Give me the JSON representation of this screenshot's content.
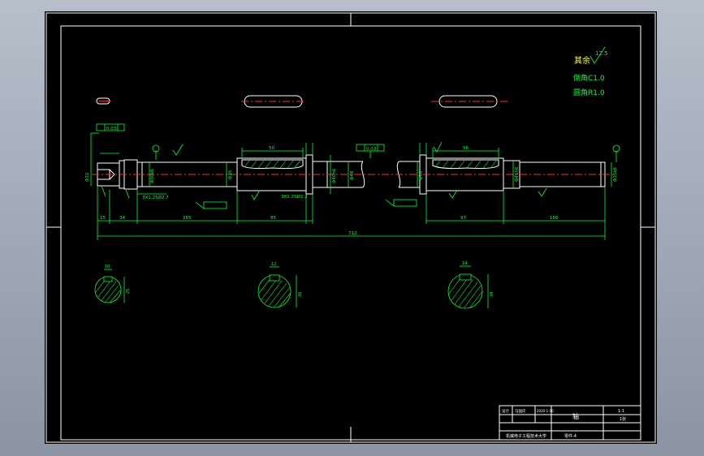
{
  "notes": {
    "rest_roughness_label": "其余",
    "rest_roughness_value": "12.5",
    "chamfer": "倒角C1.0",
    "fillet": "圆角R1.0"
  },
  "dimensions": {
    "overall_length": "712",
    "seg_left_a": "15",
    "seg_left_b": "34",
    "seg_left_c": "265",
    "seg_key_a": "85",
    "seg_right_a": "97",
    "seg_right_b": "186",
    "keyway_left_len": "50",
    "keyway_right_len": "56",
    "diam_left_end": "Φ32",
    "diam_bearing_left": "Φ30k6",
    "diam_body_left": "Φ35",
    "diam_key_left": "Φ40h6",
    "diam_collar": "Φ48",
    "diam_center": "Φ50",
    "diam_key_right": "Φ45h6",
    "diam_right_end": "Φ35k6",
    "keyway_depth_left": "3X1.25Ø2.2",
    "key_label": "3X1.25Ø2.7",
    "tol_left": "0.03",
    "tol_right": "0.03",
    "section_a_w": "10",
    "section_a_h": "25",
    "section_b_w": "12",
    "section_b_h": "36",
    "section_c_w": "14",
    "section_c_h": "39"
  },
  "title_block": {
    "designer_label": "设计",
    "designer_name": "马国庆",
    "date": "2020-1-10",
    "part_name": "轴",
    "scale": "1:1",
    "sheet": "1张",
    "school": "机械电子工程技术大学",
    "drawing_no": "零件-4"
  }
}
